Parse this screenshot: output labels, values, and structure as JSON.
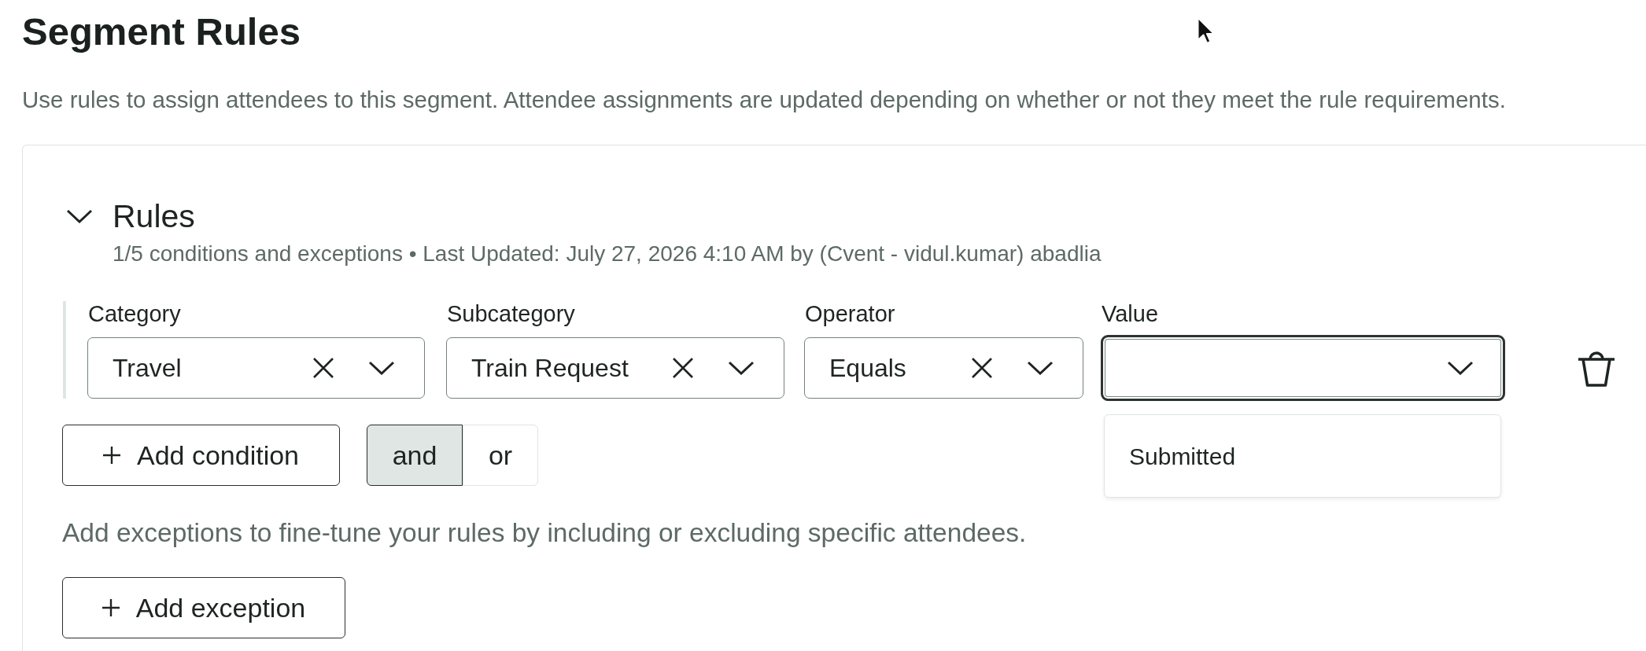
{
  "page": {
    "title": "Segment Rules",
    "description": "Use rules to assign attendees to this segment. Attendee assignments are updated depending on whether or not they meet the rule requirements."
  },
  "rules_panel": {
    "title": "Rules",
    "expanded": true,
    "summary": "1/5 conditions and exceptions • Last Updated: July 27, 2026 4:10 AM by (Cvent - vidul.kumar) abadlia",
    "conditions": [
      {
        "fields": [
          {
            "label": "Category",
            "value": "Travel",
            "focused": false
          },
          {
            "label": "Subcategory",
            "value": "Train Request",
            "focused": false
          },
          {
            "label": "Operator",
            "value": "Equals",
            "focused": false
          },
          {
            "label": "Value",
            "focused": true,
            "options": [
              "Submitted"
            ]
          }
        ]
      }
    ],
    "add_condition_button": {
      "label": "Add condition"
    },
    "logic_toggle": [
      {
        "label": "and",
        "selected": true
      },
      {
        "label": "or",
        "selected": false
      }
    ],
    "exceptions_hint": "Add exceptions to fine-tune your rules by including or excluding specific attendees.",
    "add_exception_button": {
      "label": "Add exception"
    }
  }
}
